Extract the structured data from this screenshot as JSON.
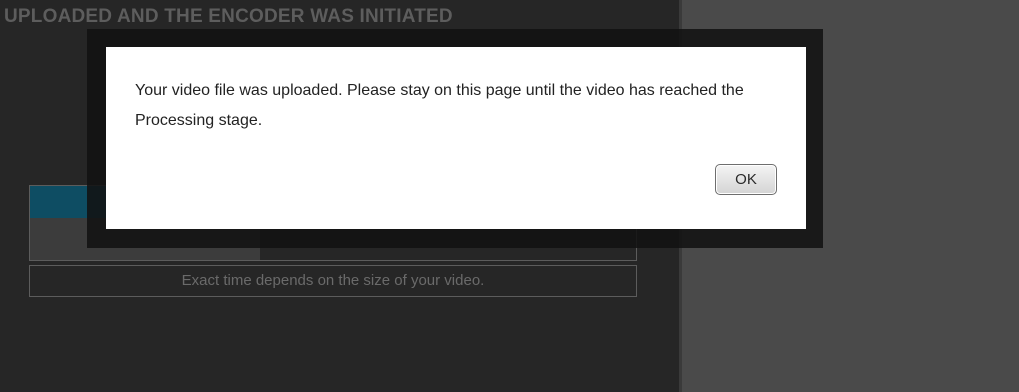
{
  "panel": {
    "title": "UPLOADED AND THE ENCODER WAS INITIATED",
    "info_text": "Exact time depends on the size of your video."
  },
  "progress": {
    "value": 0.39
  },
  "dialog": {
    "message": "Your video file was uploaded. Please stay on this page until the video has reached the Processing stage.",
    "ok_label": "OK"
  },
  "colors": {
    "progress_accent": "#0e4d63",
    "panel_bg": "#262626",
    "right_bg": "#4a4a4a"
  }
}
